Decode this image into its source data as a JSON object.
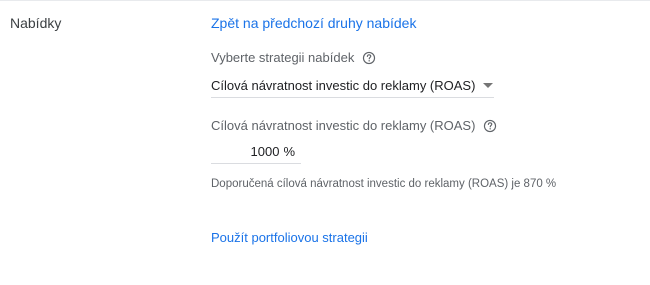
{
  "section": {
    "label": "Nabídky"
  },
  "back_link": "Zpět na předchozí druhy nabídek",
  "strategy": {
    "label": "Vyberte strategii nabídek",
    "help_icon": "help-circle-icon",
    "selected": "Cílová návratnost investic do reklamy (ROAS)",
    "dropdown_icon": "arrow-drop-down-icon"
  },
  "target_roas": {
    "label": "Cílová návratnost investic do reklamy (ROAS)",
    "help_icon": "help-circle-icon",
    "value": "1000",
    "unit": "%"
  },
  "recommendation": "Doporučená cílová návratnost investic do reklamy (ROAS) je 870 %",
  "portfolio_link": "Použít portfoliovou strategii",
  "colors": {
    "link": "#1a73e8",
    "secondary_text": "#5f6368",
    "primary_text": "#202124",
    "divider": "#dadce0"
  }
}
